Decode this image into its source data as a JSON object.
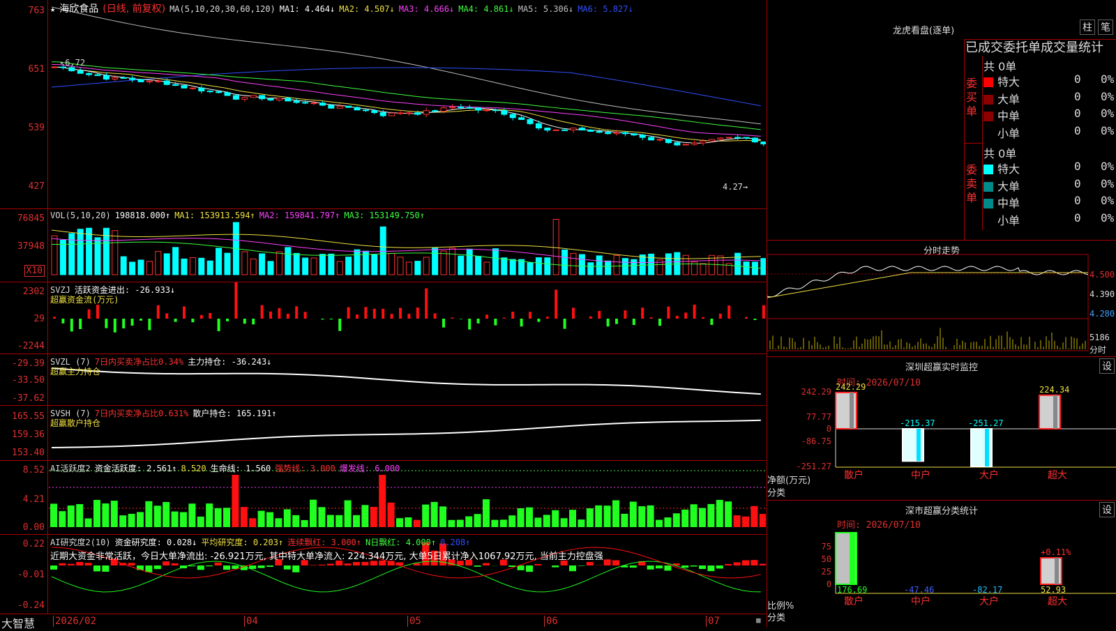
{
  "stock": {
    "name": "海欣食品",
    "mode": "(日线, 前复权)"
  },
  "ma_header": {
    "label": "MA(5,10,20,30,60,120)",
    "items": [
      {
        "t": "MA1: 4.464↓",
        "c": "#ffffff"
      },
      {
        "t": "MA2: 4.507↓",
        "c": "#f0e040"
      },
      {
        "t": "MA3: 4.666↓",
        "c": "#ff40ff"
      },
      {
        "t": "MA4: 4.861↓",
        "c": "#40ff40"
      },
      {
        "t": "MA5: 5.306↓",
        "c": "#c0c0c0"
      },
      {
        "t": "MA6: 5.827↓",
        "c": "#3050ff"
      }
    ]
  },
  "price_axis": [
    "763",
    "651",
    "539",
    "427"
  ],
  "price_marks": {
    "high": "6.72",
    "low": "4.27"
  },
  "vol_header": {
    "label": "VOL(5,10,20)",
    "value": "198818.000↑",
    "items": [
      {
        "t": "MA1: 153913.594↑",
        "c": "#f0e040"
      },
      {
        "t": "MA2: 159841.797↑",
        "c": "#ff40ff"
      },
      {
        "t": "MA3: 153149.750↑",
        "c": "#40ff40"
      }
    ]
  },
  "vol_axis": [
    "76845",
    "37948"
  ],
  "vol_unit": "X10",
  "svzj": {
    "label": "SVZJ",
    "item": "活跃资金进出: -26.933↓",
    "sub": "超赢资金流(万元)",
    "axis": [
      "2302",
      "29",
      "-2244"
    ]
  },
  "svzl": {
    "label": "SVZL (7)",
    "ratio": "7日内买卖净占比0.34%",
    "item": "主力持仓: -36.243↓",
    "sub": "超赢主力持仓",
    "axis": [
      "-29.39",
      "-33.50",
      "-37.62"
    ]
  },
  "svsh": {
    "label": "SVSH (7)",
    "ratio": "7日内买卖净占比0.631%",
    "item": "散户持仓: 165.191↑",
    "sub": "超赢散户持仓",
    "axis": [
      "165.55",
      "159.36",
      "153.40"
    ]
  },
  "ai1": {
    "label": "AI活跃度2",
    "items": [
      {
        "t": "资金活跃度: 2.561↑",
        "c": "#ffffff"
      },
      {
        "t": "8.520",
        "c": "#f0e040"
      },
      {
        "t": "生命线: 1.560",
        "c": "#ffffff"
      },
      {
        "t": "强势线: 3.000",
        "c": "#ff3030"
      },
      {
        "t": "爆发线: 6.000",
        "c": "#ff40ff"
      }
    ],
    "axis": [
      "8.52",
      "4.21",
      "0.00"
    ]
  },
  "ai2": {
    "label": "AI研究度2(10)",
    "items": [
      {
        "t": "资金研究度: 0.028↓",
        "c": "#ffffff"
      },
      {
        "t": "平均研究度: 0.203↑",
        "c": "#f0e040"
      },
      {
        "t": "连续飘红: 3.000↑",
        "c": "#ff3030"
      },
      {
        "t": "N日飘红: 4.000↑",
        "c": "#40ff40"
      },
      {
        "t": "0.208↑",
        "c": "#3050ff"
      }
    ],
    "note": "近期大资金非常活跃，今日大单净流出: -26.921万元, 其中特大单净流入: 224.344万元, 大单5日累计净入1067.92万元, 当前主力控盘强",
    "axis": [
      "0.22",
      "-0.01",
      "-0.24"
    ]
  },
  "bottom": {
    "brand": "大智慧",
    "dates": [
      "2026/02",
      "04",
      "05",
      "06",
      "07"
    ]
  },
  "longhu": {
    "title": "龙虎看盘(逐单)",
    "btn1": "柱",
    "btn2": "笔",
    "heading": "已成交委托单成交量统计",
    "buy_label": "委买单",
    "sell_label": "委卖单",
    "buy_total": "共 0单",
    "sell_total": "共 0单",
    "rows": [
      "特大",
      "大单",
      "中单",
      "小单"
    ],
    "buy_colors": [
      "#ff0000",
      "#8b0000",
      "#8b0000",
      "#000000"
    ],
    "sell_colors": [
      "#00ffff",
      "#008b8b",
      "#008b8b",
      "#000000"
    ],
    "zero": "0",
    "pct": "0%"
  },
  "fenshi": {
    "title": "分时走势",
    "axis": [
      "4.500",
      "4.390",
      "4.280"
    ],
    "vol": "5186",
    "unit": "分时"
  },
  "sz_monitor": {
    "title": "深圳超赢实时监控",
    "set": "设",
    "time": "时间: 2026/07/10",
    "axis": [
      "242.29",
      "77.77",
      "0",
      "-86.75",
      "-251.27"
    ],
    "ylabel": "净额(万元)",
    "xlabel": "分类",
    "cats": [
      "散户",
      "中户",
      "大户",
      "超大"
    ],
    "values": [
      242.29,
      -215.37,
      -251.27,
      224.34
    ],
    "value_labels": [
      "242.29",
      "-215.37",
      "-251.27",
      "224.34"
    ]
  },
  "sz_class": {
    "title": "深市超赢分类统计",
    "set": "设",
    "time": "时间: 2026/07/10",
    "axis": [
      "75",
      "50",
      "25",
      "0"
    ],
    "ylabel": "比例%",
    "xlabel": "分类",
    "cats": [
      "散户",
      "中户",
      "大户",
      "超大"
    ],
    "values": [
      "176.69",
      "-47.46",
      "-82.17",
      "52.93"
    ],
    "top_label": "+0.11%"
  }
}
